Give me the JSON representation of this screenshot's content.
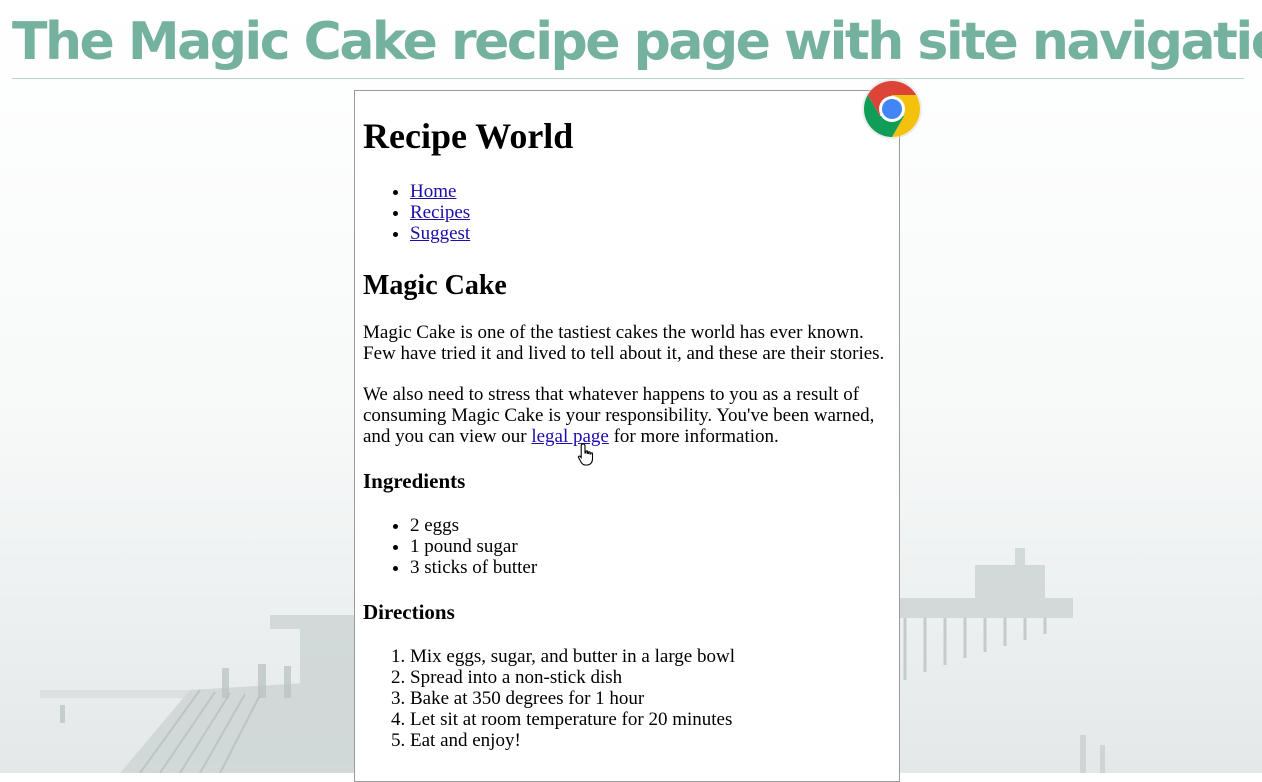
{
  "slide": {
    "title": "The Magic Cake recipe page with site navigation"
  },
  "browser": {
    "icon": "chrome-logo"
  },
  "page": {
    "site_title": "Recipe World",
    "nav": [
      {
        "label": "Home"
      },
      {
        "label": "Recipes"
      },
      {
        "label": "Suggest"
      }
    ],
    "recipe_title": "Magic Cake",
    "intro": "Magic Cake is one of the tastiest cakes the world has ever known. Few have tried it and lived to tell about it, and these are their stories.",
    "warning_before": "We also need to stress that whatever happens to you as a result of consuming Magic Cake is your responsibility. You've been warned, and you can view our ",
    "warning_link": "legal page",
    "warning_after": " for more information.",
    "ingredients_heading": "Ingredients",
    "ingredients": [
      "2 eggs",
      "1 pound sugar",
      "3 sticks of butter"
    ],
    "directions_heading": "Directions",
    "directions": [
      "Mix eggs, sugar, and butter in a large bowl",
      "Spread into a non-stick dish",
      "Bake at 350 degrees for 1 hour",
      "Let sit at room temperature for 20 minutes",
      "Eat and enjoy!"
    ]
  },
  "colors": {
    "title": "#74b19e",
    "link": "#1a0dab"
  }
}
